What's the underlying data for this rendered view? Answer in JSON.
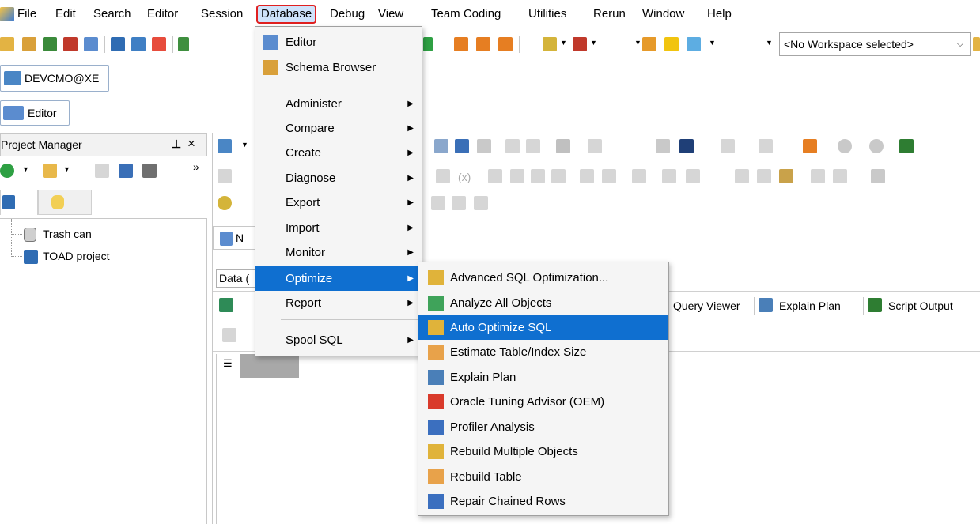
{
  "menubar": {
    "items": [
      {
        "label": "File",
        "key": "F"
      },
      {
        "label": "Edit"
      },
      {
        "label": "Search"
      },
      {
        "label": "Editor"
      },
      {
        "label": "Session"
      },
      {
        "label": "Database"
      },
      {
        "label": "Debug"
      },
      {
        "label": "View"
      },
      {
        "label": "Team Coding"
      },
      {
        "label": "Utilities"
      },
      {
        "label": "Rerun"
      },
      {
        "label": "Window"
      },
      {
        "label": "Help"
      }
    ]
  },
  "toolbar": {
    "workspace_placeholder": "<No Workspace selected>"
  },
  "connection_tab": {
    "label": "DEVCMO@XE"
  },
  "editor_tab": {
    "label": "Editor"
  },
  "project_manager": {
    "title": "Project Manager",
    "pin": "I",
    "close": "×",
    "tree": [
      {
        "label": "Trash can"
      },
      {
        "label": "TOAD project"
      }
    ]
  },
  "editor_area": {
    "tab_fragment": "N",
    "data_grid_fragment": "Data (",
    "bottom_tabs": [
      "Query Viewer",
      "Explain Plan",
      "Script Output"
    ]
  },
  "database_menu": {
    "items": [
      {
        "label": "Editor",
        "has_sub": false
      },
      {
        "label": "Schema Browser",
        "has_sub": false
      },
      {
        "label": "Administer",
        "has_sub": true
      },
      {
        "label": "Compare",
        "has_sub": true
      },
      {
        "label": "Create",
        "has_sub": true
      },
      {
        "label": "Diagnose",
        "has_sub": true
      },
      {
        "label": "Export",
        "has_sub": true
      },
      {
        "label": "Import",
        "has_sub": true
      },
      {
        "label": "Monitor",
        "has_sub": true
      },
      {
        "label": "Optimize",
        "has_sub": true,
        "highlighted": true
      },
      {
        "label": "Report",
        "has_sub": true
      },
      {
        "label": "Spool SQL",
        "has_sub": true
      }
    ]
  },
  "optimize_submenu": {
    "items": [
      {
        "label": "Advanced SQL Optimization...",
        "icon": "advanced-sql-optimization-icon"
      },
      {
        "label": "Analyze All Objects",
        "icon": "analyze-objects-icon"
      },
      {
        "label": "Auto Optimize SQL",
        "icon": "auto-optimize-sql-icon",
        "highlighted": true
      },
      {
        "label": "Estimate Table/Index Size",
        "icon": "estimate-size-icon"
      },
      {
        "label": "Explain Plan",
        "icon": "explain-plan-icon"
      },
      {
        "label": "Oracle Tuning Advisor (OEM)",
        "icon": "oracle-tuning-icon"
      },
      {
        "label": "Profiler Analysis",
        "icon": "profiler-analysis-icon"
      },
      {
        "label": "Rebuild Multiple Objects",
        "icon": "rebuild-multiple-icon"
      },
      {
        "label": "Rebuild Table",
        "icon": "rebuild-table-icon"
      },
      {
        "label": "Repair Chained Rows",
        "icon": "repair-chained-rows-icon"
      }
    ]
  },
  "colors": {
    "highlight": "#0f6fd0",
    "active_menu_border": "#e02020",
    "menu_bg": "#f5f5f5"
  }
}
